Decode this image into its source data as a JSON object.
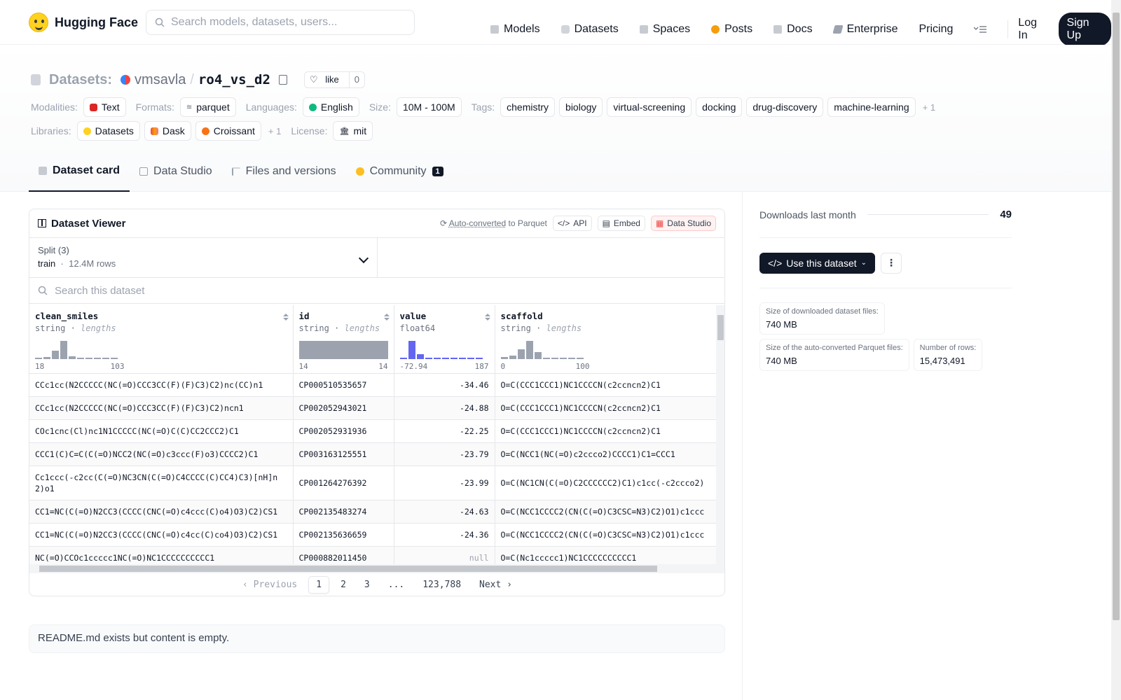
{
  "app": {
    "logo_text": "Hugging Face"
  },
  "search": {
    "placeholder": "Search models, datasets, users..."
  },
  "nav": {
    "models": "Models",
    "datasets": "Datasets",
    "spaces": "Spaces",
    "posts": "Posts",
    "docs": "Docs",
    "enterprise": "Enterprise",
    "pricing": "Pricing",
    "login": "Log In",
    "signup": "Sign Up"
  },
  "breadcrumb": {
    "section": "Datasets:",
    "user": "vmsavla",
    "sep": "/",
    "name": "ro4_vs_d2"
  },
  "like": {
    "label": "like",
    "count": "0"
  },
  "meta": {
    "modalities_label": "Modalities:",
    "modality": "Text",
    "formats_label": "Formats:",
    "format": "parquet",
    "languages_label": "Languages:",
    "language": "English",
    "size_label": "Size:",
    "size": "10M - 100M",
    "tags_label": "Tags:",
    "tags": [
      "chemistry",
      "biology",
      "virtual-screening",
      "docking",
      "drug-discovery",
      "machine-learning"
    ],
    "tags_more": "+ 1",
    "libraries_label": "Libraries:",
    "libraries": [
      "Datasets",
      "Dask",
      "Croissant"
    ],
    "libraries_more": "+ 1",
    "license_label": "License:",
    "license": "mit"
  },
  "tabs": {
    "card": "Dataset card",
    "studio": "Data Studio",
    "files": "Files and versions",
    "community": "Community",
    "community_count": "1"
  },
  "viewer": {
    "title": "Dataset Viewer",
    "autoconv_link": "Auto-converted",
    "autoconv_rest": "to Parquet",
    "api": "API",
    "embed": "Embed",
    "studio": "Data Studio",
    "split_label": "Split (3)",
    "split_name": "train",
    "split_dot": "·",
    "split_rows": "12.4M rows",
    "search_placeholder": "Search this dataset",
    "columns": [
      {
        "name": "clean_smiles",
        "type": "string",
        "stat": "lengths",
        "min": "18",
        "max": "103"
      },
      {
        "name": "id",
        "type": "string",
        "stat": "lengths",
        "min": "14",
        "max": "14"
      },
      {
        "name": "value",
        "type": "float64",
        "stat": "",
        "min": "-72.94",
        "max": "187"
      },
      {
        "name": "scaffold",
        "type": "string",
        "stat": "lengths",
        "min": "0",
        "max": "100"
      }
    ],
    "rows": [
      [
        "CCc1cc(N2CCCCC(NC(=O)CCC3CC(F)(F)C3)C2)nc(CC)n1",
        "CP000510535657",
        "-34.46",
        "O=C(CCC1CCC1)NC1CCCCN(c2ccncn2)C1"
      ],
      [
        "CCc1cc(N2CCCCC(NC(=O)CCC3CC(F)(F)C3)C2)ncn1",
        "CP002052943021",
        "-24.88",
        "O=C(CCC1CCC1)NC1CCCCN(c2ccncn2)C1"
      ],
      [
        "COc1cnc(Cl)nc1N1CCCCC(NC(=O)C(C)CC2CCC2)C1",
        "CP002052931936",
        "-22.25",
        "O=C(CCC1CCC1)NC1CCCCN(c2ccncn2)C1"
      ],
      [
        "CCC1(C)C=C(C(=O)NCC2(NC(=O)c3ccc(F)o3)CCCC2)C1",
        "CP003163125551",
        "-23.79",
        "O=C(NCC1(NC(=O)c2ccco2)CCCC1)C1=CCC1"
      ],
      [
        "Cc1ccc(-c2cc(C(=O)NC3CN(C(=O)C4CCCC(C)CC4)C3)[nH]n2)o1",
        "CP001264276392",
        "-23.99",
        "O=C(NC1CN(C(=O)C2CCCCCC2)C1)c1cc(-c2ccco2)"
      ],
      [
        "CC1=NC(C(=O)N2CC3(CCCC(CNC(=O)c4ccc(C)o4)O3)C2)CS1",
        "CP002135483274",
        "-24.63",
        "O=C(NCC1CCCC2(CN(C(=O)C3CSC=N3)C2)O1)c1ccc"
      ],
      [
        "CC1=NC(C(=O)N2CC3(CCCC(CNC(=O)c4cc(C)co4)O3)C2)CS1",
        "CP002135636659",
        "-24.36",
        "O=C(NCC1CCCC2(CN(C(=O)C3CSC=N3)C2)O1)c1ccc"
      ],
      [
        "NC(=O)CCOc1ccccc1NC(=O)NC1CCCCCCCCCC1",
        "CP000882011450",
        "null",
        "O=C(Nc1ccccc1)NC1CCCCCCCCCC1"
      ]
    ],
    "pager": {
      "prev": "Previous",
      "p1": "1",
      "p2": "2",
      "p3": "3",
      "ellipsis": "...",
      "last": "123,788",
      "next": "Next"
    }
  },
  "readme": "README.md exists but content is empty.",
  "sidebar": {
    "downloads_label": "Downloads last month",
    "downloads": "49",
    "use_button": "Use this dataset",
    "dl_size_label": "Size of downloaded dataset files:",
    "dl_size": "740 MB",
    "parquet_size_label": "Size of the auto-converted Parquet files:",
    "parquet_size": "740 MB",
    "rows_label": "Number of rows:",
    "rows": "15,473,491"
  },
  "colors": {
    "accent_dark": "#111827",
    "hist_gray": "#9ca3af",
    "hist_blue": "#6366f1",
    "logo_yellow": "#ffd21e"
  },
  "histograms": {
    "clean_smiles": [
      0.04,
      0.1,
      0.45,
      1.0,
      0.15,
      0.05,
      0.04,
      0.04,
      0.04,
      0.04
    ],
    "id": [
      1.0
    ],
    "value": [
      0.04,
      1.0,
      0.25,
      0.04,
      0.04,
      0.04,
      0.04,
      0.04,
      0.04,
      0.04
    ],
    "scaffold": [
      0.12,
      0.2,
      0.55,
      1.0,
      0.4,
      0.06,
      0.04,
      0.04,
      0.04,
      0.04
    ]
  }
}
